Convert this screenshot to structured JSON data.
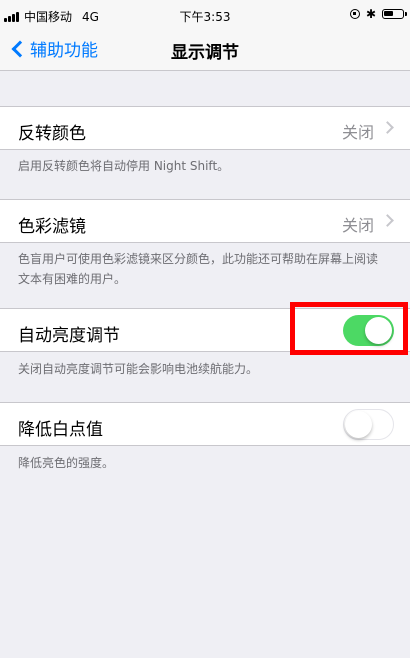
{
  "status_bar": {
    "carrier": "中国移动",
    "network": "4G",
    "time": "下午3:53",
    "bluetooth": "✱"
  },
  "nav": {
    "back_label": "辅助功能",
    "title": "显示调节"
  },
  "cells": {
    "invert": {
      "label": "反转颜色",
      "value": "关闭",
      "footer": "启用反转颜色将自动停用 Night Shift。"
    },
    "color_filters": {
      "label": "色彩滤镜",
      "value": "关闭",
      "footer": "色盲用户可使用色彩滤镜来区分颜色，此功能还可帮助在屏幕上阅读文本有困难的用户。"
    },
    "auto_brightness": {
      "label": "自动亮度调节",
      "toggle": "on",
      "footer": "关闭自动亮度调节可能会影响电池续航能力。"
    },
    "reduce_white_point": {
      "label": "降低白点值",
      "toggle": "off",
      "footer": "降低亮色的强度。"
    }
  },
  "colors": {
    "accent": "#007aff",
    "toggle_on": "#4cd964",
    "highlight": "#ff0000"
  }
}
